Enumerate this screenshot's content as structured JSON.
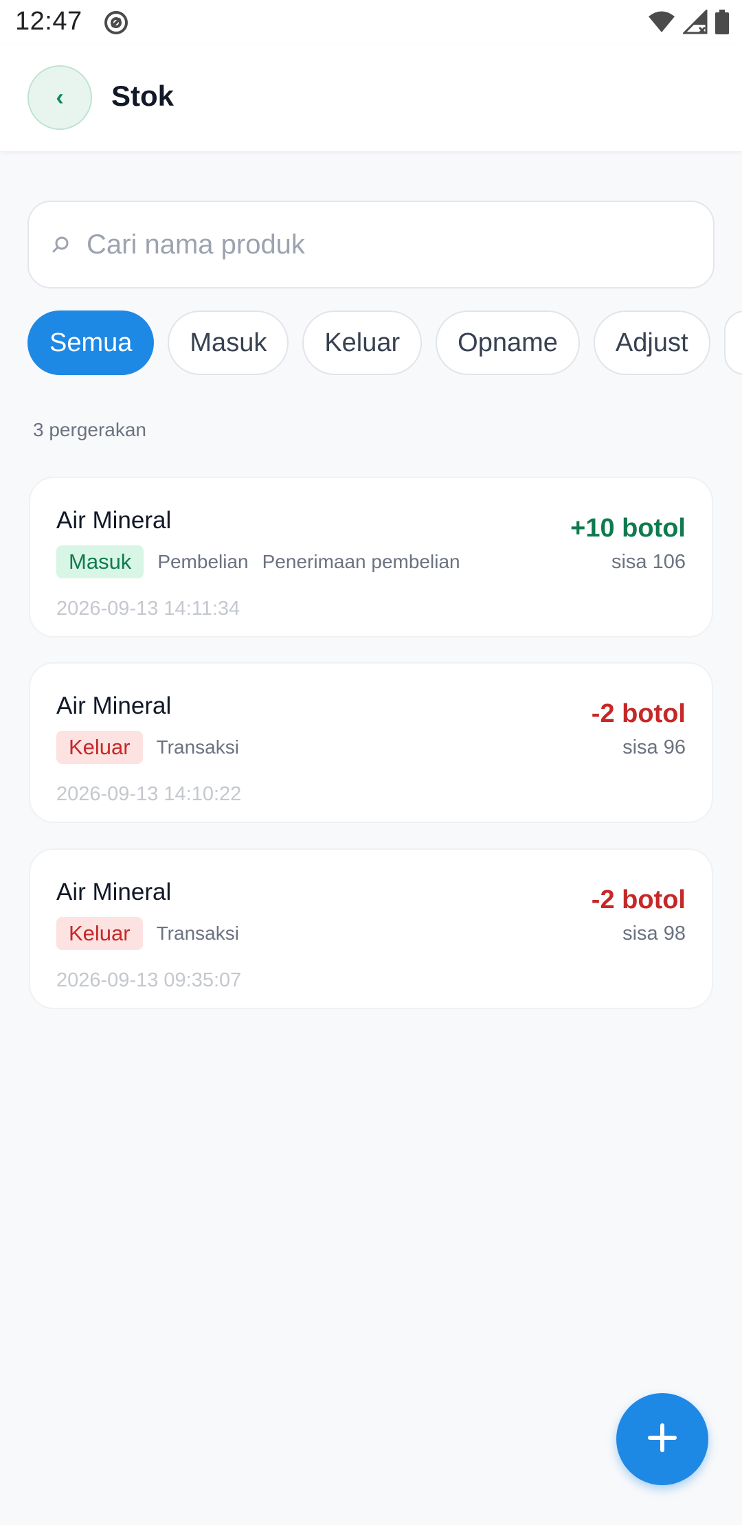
{
  "status_bar": {
    "time": "12:47",
    "icons": [
      "at-sign-icon",
      "wifi-icon",
      "signal-icon",
      "battery-icon"
    ]
  },
  "app_bar": {
    "back_icon": "‹",
    "title": "Stok"
  },
  "search": {
    "placeholder": "Cari nama produk",
    "value": ""
  },
  "filters": [
    {
      "label": "Semua",
      "active": true
    },
    {
      "label": "Masuk",
      "active": false
    },
    {
      "label": "Keluar",
      "active": false
    },
    {
      "label": "Opname",
      "active": false
    },
    {
      "label": "Adjust",
      "active": false
    }
  ],
  "movement_count": "3 pergerakan",
  "movements": [
    {
      "product": "Air Mineral",
      "type": "Masuk",
      "source": "Pembelian",
      "note": "Penerimaan pembelian",
      "datetime": "2026-09-13 14:11:34",
      "quantity": "+10 botol",
      "remaining": "sisa 106"
    },
    {
      "product": "Air Mineral",
      "type": "Keluar",
      "source": "Transaksi",
      "note": "",
      "datetime": "2026-09-13 14:10:22",
      "quantity": "-2 botol",
      "remaining": "sisa 96"
    },
    {
      "product": "Air Mineral",
      "type": "Keluar",
      "source": "Transaksi",
      "note": "",
      "datetime": "2026-09-13 09:35:07",
      "quantity": "-2 botol",
      "remaining": "sisa 98"
    }
  ],
  "colors": {
    "primary": "#1e88e5",
    "in": "#0f7a4f",
    "out": "#c62828",
    "back_button_bg": "#e8f5ef"
  },
  "fab_icon": "plus-icon"
}
